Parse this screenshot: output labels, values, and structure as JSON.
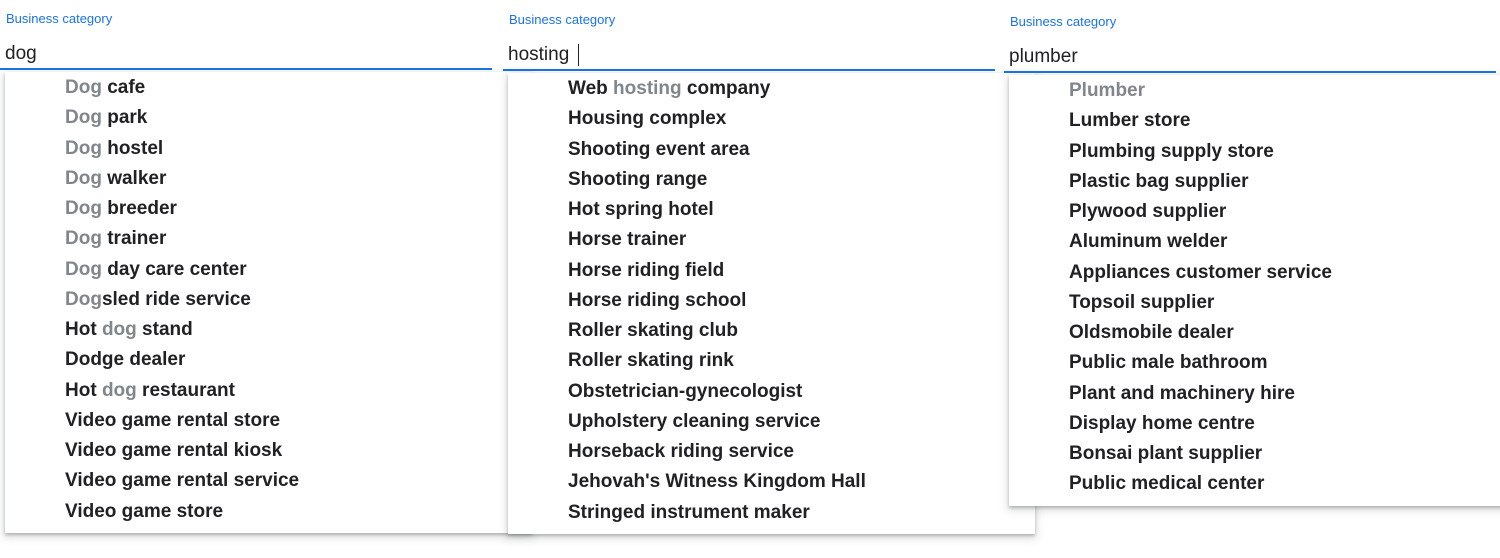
{
  "panels": [
    {
      "label": "Business category",
      "input_value": "dog",
      "suggestions": [
        {
          "parts": [
            {
              "text": "Dog",
              "hl": true
            },
            {
              "text": " cafe",
              "hl": false
            }
          ]
        },
        {
          "parts": [
            {
              "text": "Dog",
              "hl": true
            },
            {
              "text": " park",
              "hl": false
            }
          ]
        },
        {
          "parts": [
            {
              "text": "Dog",
              "hl": true
            },
            {
              "text": " hostel",
              "hl": false
            }
          ]
        },
        {
          "parts": [
            {
              "text": "Dog",
              "hl": true
            },
            {
              "text": " walker",
              "hl": false
            }
          ]
        },
        {
          "parts": [
            {
              "text": "Dog",
              "hl": true
            },
            {
              "text": " breeder",
              "hl": false
            }
          ]
        },
        {
          "parts": [
            {
              "text": "Dog",
              "hl": true
            },
            {
              "text": " trainer",
              "hl": false
            }
          ]
        },
        {
          "parts": [
            {
              "text": "Dog",
              "hl": true
            },
            {
              "text": " day care center",
              "hl": false
            }
          ]
        },
        {
          "parts": [
            {
              "text": "Dog",
              "hl": true
            },
            {
              "text": "sled ride service",
              "hl": false
            }
          ]
        },
        {
          "parts": [
            {
              "text": "Hot ",
              "hl": false
            },
            {
              "text": "dog",
              "hl": true
            },
            {
              "text": " stand",
              "hl": false
            }
          ]
        },
        {
          "parts": [
            {
              "text": "Dodge dealer",
              "hl": false
            }
          ]
        },
        {
          "parts": [
            {
              "text": "Hot ",
              "hl": false
            },
            {
              "text": "dog",
              "hl": true
            },
            {
              "text": " restaurant",
              "hl": false
            }
          ]
        },
        {
          "parts": [
            {
              "text": "Video game rental store",
              "hl": false
            }
          ]
        },
        {
          "parts": [
            {
              "text": "Video game rental kiosk",
              "hl": false
            }
          ]
        },
        {
          "parts": [
            {
              "text": "Video game rental service",
              "hl": false
            }
          ]
        },
        {
          "parts": [
            {
              "text": "Video game store",
              "hl": false
            }
          ]
        }
      ]
    },
    {
      "label": "Business category",
      "input_value": "hosting",
      "suggestions": [
        {
          "parts": [
            {
              "text": "Web ",
              "hl": false
            },
            {
              "text": "hosting",
              "hl": true
            },
            {
              "text": " company",
              "hl": false
            }
          ]
        },
        {
          "parts": [
            {
              "text": "Housing complex",
              "hl": false
            }
          ]
        },
        {
          "parts": [
            {
              "text": "Shooting event area",
              "hl": false
            }
          ]
        },
        {
          "parts": [
            {
              "text": "Shooting range",
              "hl": false
            }
          ]
        },
        {
          "parts": [
            {
              "text": "Hot spring hotel",
              "hl": false
            }
          ]
        },
        {
          "parts": [
            {
              "text": "Horse trainer",
              "hl": false
            }
          ]
        },
        {
          "parts": [
            {
              "text": "Horse riding field",
              "hl": false
            }
          ]
        },
        {
          "parts": [
            {
              "text": "Horse riding school",
              "hl": false
            }
          ]
        },
        {
          "parts": [
            {
              "text": "Roller skating club",
              "hl": false
            }
          ]
        },
        {
          "parts": [
            {
              "text": "Roller skating rink",
              "hl": false
            }
          ]
        },
        {
          "parts": [
            {
              "text": "Obstetrician-gynecologist",
              "hl": false
            }
          ]
        },
        {
          "parts": [
            {
              "text": "Upholstery cleaning service",
              "hl": false
            }
          ]
        },
        {
          "parts": [
            {
              "text": "Horseback riding service",
              "hl": false
            }
          ]
        },
        {
          "parts": [
            {
              "text": "Jehovah's Witness Kingdom Hall",
              "hl": false
            }
          ]
        },
        {
          "parts": [
            {
              "text": "Stringed instrument maker",
              "hl": false
            }
          ]
        }
      ]
    },
    {
      "label": "Business category",
      "input_value": "plumber",
      "suggestions": [
        {
          "parts": [
            {
              "text": "Plumber",
              "hl": true
            }
          ]
        },
        {
          "parts": [
            {
              "text": "Lumber store",
              "hl": false
            }
          ]
        },
        {
          "parts": [
            {
              "text": "Plumbing supply store",
              "hl": false
            }
          ]
        },
        {
          "parts": [
            {
              "text": "Plastic bag supplier",
              "hl": false
            }
          ]
        },
        {
          "parts": [
            {
              "text": "Plywood supplier",
              "hl": false
            }
          ]
        },
        {
          "parts": [
            {
              "text": "Aluminum welder",
              "hl": false
            }
          ]
        },
        {
          "parts": [
            {
              "text": "Appliances customer service",
              "hl": false
            }
          ]
        },
        {
          "parts": [
            {
              "text": "Topsoil supplier",
              "hl": false
            }
          ]
        },
        {
          "parts": [
            {
              "text": "Oldsmobile dealer",
              "hl": false
            }
          ]
        },
        {
          "parts": [
            {
              "text": "Public male bathroom",
              "hl": false
            }
          ]
        },
        {
          "parts": [
            {
              "text": "Plant and machinery hire",
              "hl": false
            }
          ]
        },
        {
          "parts": [
            {
              "text": "Display home centre",
              "hl": false
            }
          ]
        },
        {
          "parts": [
            {
              "text": "Bonsai plant supplier",
              "hl": false
            }
          ]
        },
        {
          "parts": [
            {
              "text": "Public medical center",
              "hl": false
            }
          ]
        }
      ]
    }
  ],
  "colors": {
    "accent": "#1a73e8",
    "text": "#202124",
    "match_text": "#80868b"
  }
}
